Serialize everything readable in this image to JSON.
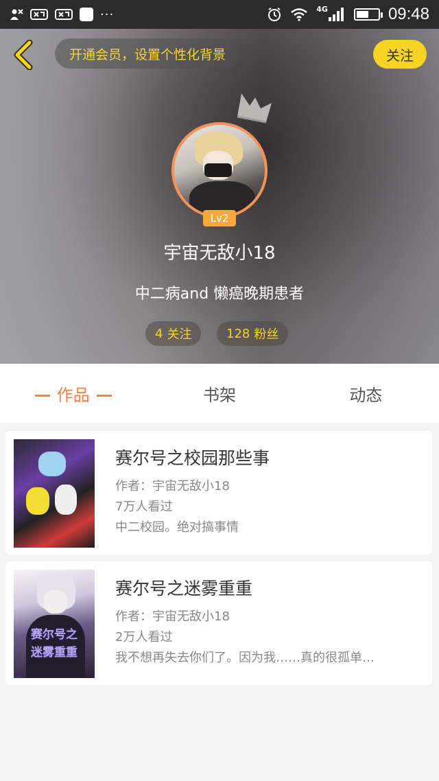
{
  "status_bar": {
    "left_icons": [
      "person-x-icon",
      "mic-icon",
      "mic-icon",
      "square-icon",
      "more-dots-icon"
    ],
    "dots": "···",
    "network": "4G",
    "battery_level": 0.55,
    "time": "09:48"
  },
  "header": {
    "vip_banner": "开通会员，设置个性化背景",
    "follow_label": "关注",
    "level": "Lv2",
    "nickname": "宇宙无敌小18",
    "bio": "中二病and 懒癌晚期患者",
    "stats": {
      "follow_count": "4",
      "follow_label": "关注",
      "fans_count": "128",
      "fans_label": "粉丝"
    }
  },
  "tabs": [
    {
      "label": "作品",
      "active": true
    },
    {
      "label": "书架",
      "active": false
    },
    {
      "label": "动态",
      "active": false
    }
  ],
  "books": [
    {
      "title": "赛尔号之校园那些事",
      "author": "作者：宇宙无敌小18",
      "views": "7万人看过",
      "desc": "中二校园。绝对搞事情"
    },
    {
      "title": "赛尔号之迷雾重重",
      "author": "作者：宇宙无敌小18",
      "views": "2万人看过",
      "desc": "我不想再失去你们了。因为我……真的很孤单…",
      "cover_text": [
        "赛尔号之",
        "迷雾重重"
      ]
    }
  ],
  "colors": {
    "accent": "#f0814a",
    "yellow": "#f7d424",
    "gold_text": "#f5d53a"
  }
}
